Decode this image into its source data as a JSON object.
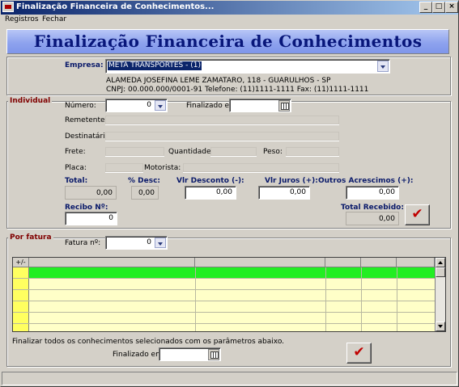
{
  "window": {
    "title": "Finalização Financeira de Conhecimentos...",
    "minimize_glyph": "_",
    "maximize_glyph": "□",
    "close_glyph": "×"
  },
  "menu": [
    "Registros",
    "Fechar"
  ],
  "banner": "Finalização Financeira de Conhecimentos",
  "empresa": {
    "label": "Empresa:",
    "value": "META TRANSPORTES - (1)",
    "address": "ALAMEDA JOSEFINA LEME ZAMATARO, 118 - GUARULHOS - SP",
    "contact": "CNPJ: 00.000.000/0001-91 Telefone: (11)1111-1111 Fax: (11)1111-1111"
  },
  "individual": {
    "title": "Individual",
    "numero_label": "Número:",
    "numero_value": "0",
    "finalizado_label": "Finalizado em:",
    "finalizado_value": "",
    "remetente_label": "Remetente:",
    "destinatario_label": "Destinatário:",
    "frete_label": "Frete:",
    "quantidade_label": "Quantidade:",
    "peso_label": "Peso:",
    "placa_label": "Placa:",
    "motorista_label": "Motorista:",
    "total_label": "Total:",
    "total_value": "0,00",
    "desc_label": "% Desc:",
    "desc_value": "0,00",
    "vlr_desconto_label": "Vlr Desconto (-):",
    "vlr_desconto_value": "0,00",
    "vlr_juros_label": "Vlr Juros (+):",
    "vlr_juros_value": "0,00",
    "outros_label": "Outros Acrescimos (+):",
    "outros_value": "0,00",
    "recibo_label": "Recibo Nº:",
    "recibo_value": "0",
    "total_recebido_label": "Total Recebido:",
    "total_recebido_value": "0,00",
    "confirm_glyph": "✔"
  },
  "por_fatura": {
    "title": "Por fatura",
    "fatura_label": "Fatura nº:",
    "fatura_value": "0",
    "grid_toggle": "+/-",
    "grid_rows": 6,
    "hint": "Finalizar todos os conhecimentos selecionados com os parâmetros abaixo.",
    "finalizado_label": "Finalizado em:",
    "finalizado_value": "",
    "confirm_glyph": "✔"
  },
  "colors": {
    "title_bar": "#0a246a",
    "banner_text": "#08167a",
    "group_title": "#800000",
    "grid_selected_row": "#22ee22",
    "grid_row_bg": "#ffffc8",
    "confirm_check": "#c00000"
  },
  "icons": {
    "app": "app-icon",
    "dropdown": "chevron-down-icon",
    "calendar": "calendar-icon",
    "confirm": "checkmark-icon"
  }
}
